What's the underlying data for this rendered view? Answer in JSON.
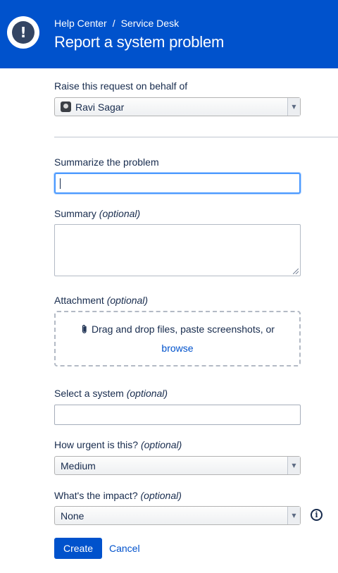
{
  "header": {
    "icon_glyph": "!",
    "breadcrumb": [
      "Help Center",
      "Service Desk"
    ],
    "breadcrumb_separator": "/",
    "title": "Report a system problem"
  },
  "form": {
    "behalf": {
      "label": "Raise this request on behalf of",
      "value": "Ravi Sagar",
      "arrow": "▼"
    },
    "summarize": {
      "label": "Summarize the problem",
      "value": ""
    },
    "summary": {
      "label": "Summary",
      "optional": "(optional)",
      "value": ""
    },
    "attachment": {
      "label": "Attachment",
      "optional": "(optional)",
      "drop_text": "Drag and drop files, paste screenshots, or",
      "browse": "browse"
    },
    "system": {
      "label": "Select a system",
      "optional": "(optional)",
      "value": ""
    },
    "urgency": {
      "label": "How urgent is this?",
      "optional": "(optional)",
      "value": "Medium",
      "arrow": "▼"
    },
    "impact": {
      "label": "What's the impact?",
      "optional": "(optional)",
      "value": "None",
      "arrow": "▼",
      "info_glyph": "i"
    },
    "actions": {
      "create": "Create",
      "cancel": "Cancel"
    }
  },
  "colors": {
    "header_bg": "#0052cc",
    "primary": "#0052cc",
    "focus": "#4c9aff",
    "text": "#172b4d"
  }
}
